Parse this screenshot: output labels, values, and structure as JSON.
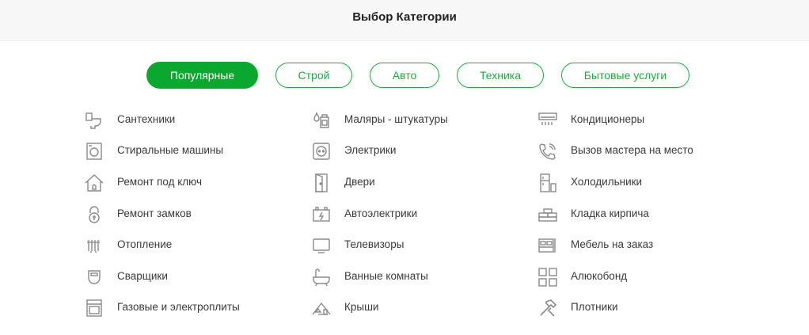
{
  "header": {
    "title": "Выбор Категории"
  },
  "tabs": [
    {
      "label": "Популярные",
      "active": true
    },
    {
      "label": "Строй",
      "active": false
    },
    {
      "label": "Авто",
      "active": false
    },
    {
      "label": "Техника",
      "active": false
    },
    {
      "label": "Бытовые услуги",
      "active": false
    }
  ],
  "categories": {
    "col1": [
      {
        "label": "Сантехники",
        "icon": "toilet-icon"
      },
      {
        "label": "Стиральные машины",
        "icon": "washing-machine-icon"
      },
      {
        "label": "Ремонт под ключ",
        "icon": "house-icon"
      },
      {
        "label": "Ремонт замков",
        "icon": "lock-icon"
      },
      {
        "label": "Отопление",
        "icon": "radiator-icon"
      },
      {
        "label": "Сварщики",
        "icon": "welding-mask-icon"
      },
      {
        "label": "Газовые и электроплиты",
        "icon": "stove-icon"
      }
    ],
    "col2": [
      {
        "label": "Маляры - штукатуры",
        "icon": "paint-bucket-icon"
      },
      {
        "label": "Электрики",
        "icon": "socket-icon"
      },
      {
        "label": "Двери",
        "icon": "door-icon"
      },
      {
        "label": "Автоэлектрики",
        "icon": "car-battery-icon"
      },
      {
        "label": "Телевизоры",
        "icon": "tv-icon"
      },
      {
        "label": "Ванные комнаты",
        "icon": "bathtub-icon"
      },
      {
        "label": "Крыши",
        "icon": "roof-icon"
      }
    ],
    "col3": [
      {
        "label": "Кондиционеры",
        "icon": "air-conditioner-icon"
      },
      {
        "label": "Вызов мастера на место",
        "icon": "phone-call-icon"
      },
      {
        "label": "Холодильники",
        "icon": "fridge-icon"
      },
      {
        "label": "Кладка кирпича",
        "icon": "bricks-icon"
      },
      {
        "label": "Мебель на заказ",
        "icon": "bed-icon"
      },
      {
        "label": "Алюкобонд",
        "icon": "panels-icon"
      },
      {
        "label": "Плотники",
        "icon": "hammer-icon"
      }
    ]
  },
  "colors": {
    "accent": "#0aa82e",
    "accent_border": "#1faa3c",
    "icon": "#8a8a8a"
  }
}
